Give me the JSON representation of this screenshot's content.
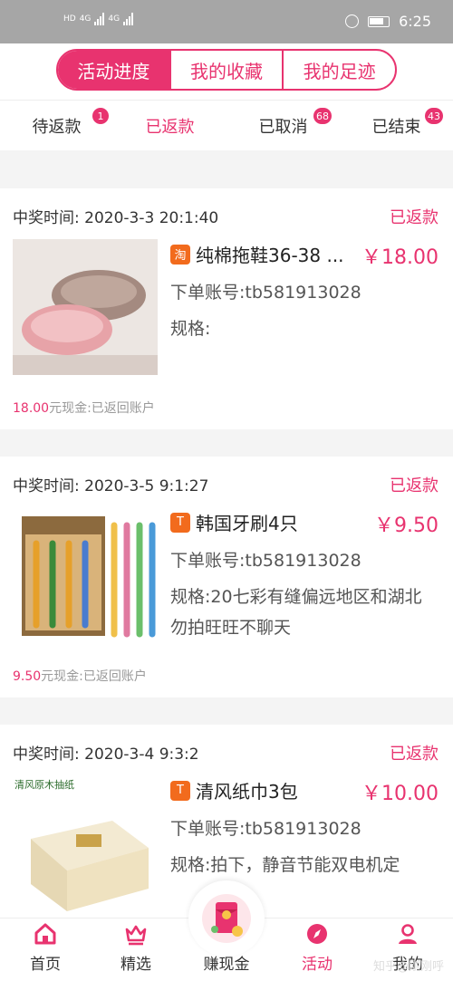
{
  "status_bar": {
    "network1": "4G",
    "network2": "4G",
    "time": "6:25"
  },
  "top_tabs": [
    "活动进度",
    "我的收藏",
    "我的足迹"
  ],
  "filters": [
    {
      "label": "待返款",
      "badge": "1"
    },
    {
      "label": "已返款",
      "badge": ""
    },
    {
      "label": "已取消",
      "badge": "68"
    },
    {
      "label": "已结束",
      "badge": "43"
    }
  ],
  "orders": [
    {
      "time": "中奖时间:  2020-3-3 20:1:40",
      "status": "已返款",
      "platform_icon": "淘",
      "title": "纯棉拖鞋36-38 ...",
      "price": "￥18.00",
      "account": "下单账号:tb581913028",
      "spec": "规格:",
      "cash_amount": "18.00",
      "cash_text": "元现金:已返回账户"
    },
    {
      "time": "中奖时间:  2020-3-5 9:1:27",
      "status": "已返款",
      "platform_icon": "T",
      "title": "韩国牙刷4只",
      "price": "￥9.50",
      "account": "下单账号:tb581913028",
      "spec": "规格:20七彩有缝偏远地区和湖北勿拍旺旺不聊天",
      "cash_amount": "9.50",
      "cash_text": "元现金:已返回账户"
    },
    {
      "time": "中奖时间:  2020-3-4 9:3:2",
      "status": "已返款",
      "platform_icon": "T",
      "title": "清风纸巾3包",
      "price": "￥10.00",
      "account": "下单账号:tb581913028",
      "spec": "规格:拍下，静音节能双电机定",
      "thumb_label": "清风原木抽纸"
    }
  ],
  "bottom_tabs": [
    "首页",
    "精选",
    "赚现金",
    "活动",
    "我的"
  ],
  "watermark": "知乎@刚刚呼",
  "colors": {
    "accent": "#e8336f",
    "taobao": "#f26b1d"
  }
}
